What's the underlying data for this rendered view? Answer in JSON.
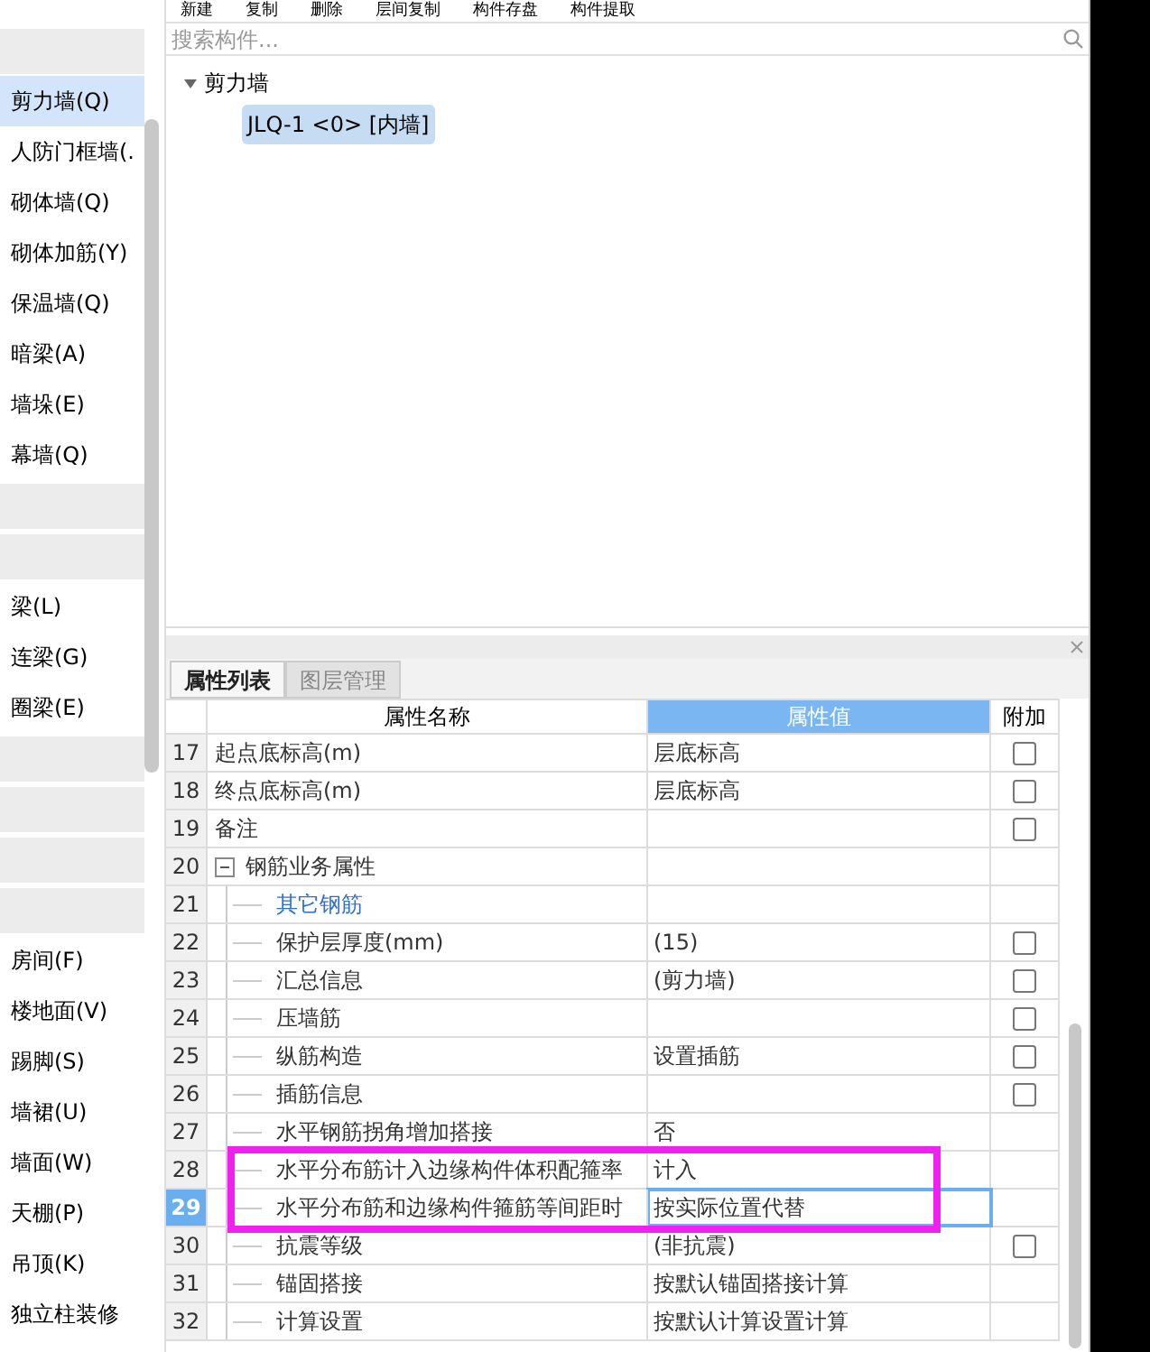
{
  "sidebar": {
    "items": [
      {
        "kind": "group"
      },
      {
        "kind": "item",
        "label": "剪力墙(Q)",
        "selected": true
      },
      {
        "kind": "item",
        "label": "人防门框墙(.",
        "selected": false
      },
      {
        "kind": "item",
        "label": "砌体墙(Q)",
        "selected": false
      },
      {
        "kind": "item",
        "label": "砌体加筋(Y)",
        "selected": false
      },
      {
        "kind": "item",
        "label": "保温墙(Q)",
        "selected": false
      },
      {
        "kind": "item",
        "label": "暗梁(A)",
        "selected": false
      },
      {
        "kind": "item",
        "label": "墙垛(E)",
        "selected": false
      },
      {
        "kind": "item",
        "label": "幕墙(Q)",
        "selected": false
      },
      {
        "kind": "group"
      },
      {
        "kind": "group"
      },
      {
        "kind": "item",
        "label": "梁(L)",
        "selected": false
      },
      {
        "kind": "item",
        "label": "连梁(G)",
        "selected": false
      },
      {
        "kind": "item",
        "label": "圈梁(E)",
        "selected": false
      },
      {
        "kind": "group"
      },
      {
        "kind": "group"
      },
      {
        "kind": "group"
      },
      {
        "kind": "group"
      },
      {
        "kind": "item",
        "label": "房间(F)",
        "selected": false
      },
      {
        "kind": "item",
        "label": "楼地面(V)",
        "selected": false
      },
      {
        "kind": "item",
        "label": "踢脚(S)",
        "selected": false
      },
      {
        "kind": "item",
        "label": "墙裙(U)",
        "selected": false
      },
      {
        "kind": "item",
        "label": "墙面(W)",
        "selected": false
      },
      {
        "kind": "item",
        "label": "天棚(P)",
        "selected": false
      },
      {
        "kind": "item",
        "label": "吊顶(K)",
        "selected": false
      },
      {
        "kind": "item",
        "label": "独立柱装修",
        "selected": false
      }
    ]
  },
  "toolbar": [
    {
      "label": "新建"
    },
    {
      "label": "复制"
    },
    {
      "label": "删除"
    },
    {
      "label": "层间复制"
    },
    {
      "label": "构件存盘"
    },
    {
      "label": "构件提取"
    }
  ],
  "search": {
    "placeholder": "搜索构件..."
  },
  "tree": {
    "label": "剪力墙",
    "expanded": true,
    "children": [
      {
        "label": "JLQ-1 <0> [内墙]",
        "selected": true
      }
    ]
  },
  "tabs": [
    {
      "label": "属性列表",
      "selected": true
    },
    {
      "label": "图层管理",
      "selected": false
    }
  ],
  "table": {
    "columns": [
      "属性名称",
      "属性值",
      "附加"
    ],
    "rows": [
      {
        "index": "17",
        "name": "起点底标高(m)",
        "value": "层底标高",
        "kind": "check",
        "checked": false,
        "selected": false
      },
      {
        "index": "18",
        "name": "终点底标高(m)",
        "value": "层底标高",
        "kind": "check",
        "checked": false,
        "selected": false
      },
      {
        "index": "19",
        "name": "备注",
        "kind": "check",
        "checked": false,
        "selected": false
      },
      {
        "index": "20",
        "name": "钢筋业务属性",
        "kind": "plain",
        "selected": false,
        "expanded": true,
        "children": [
          {
            "index": "21",
            "name": "其它钢筋",
            "kind": "link",
            "selected": false
          },
          {
            "index": "22",
            "name": "保护层厚度(mm)",
            "value": "(15)",
            "kind": "check",
            "checked": false,
            "selected": false
          },
          {
            "index": "23",
            "name": "汇总信息",
            "value": "(剪力墙)",
            "kind": "check",
            "checked": false,
            "selected": false
          },
          {
            "index": "24",
            "name": "压墙筋",
            "kind": "check",
            "checked": false,
            "selected": false
          },
          {
            "index": "25",
            "name": "纵筋构造",
            "value": "设置插筋",
            "kind": "check",
            "checked": false,
            "selected": false
          },
          {
            "index": "26",
            "name": "插筋信息",
            "kind": "check",
            "checked": false,
            "selected": false
          },
          {
            "index": "27",
            "name": "水平钢筋拐角增加搭接",
            "value": "否",
            "kind": "plain",
            "selected": false
          },
          {
            "index": "28",
            "name": "水平分布筋计入边缘构件体积配箍率",
            "value": "计入",
            "kind": "plain",
            "selected": false
          },
          {
            "index": "29",
            "name": "水平分布筋和边缘构件箍筋等间距时",
            "value": "按实际位置代替",
            "kind": "plain",
            "selected": true
          },
          {
            "index": "30",
            "name": "抗震等级",
            "value": "(非抗震)",
            "kind": "check",
            "checked": false,
            "selected": false
          },
          {
            "index": "31",
            "name": "锚固搭接",
            "value": "按默认锚固搭接计算",
            "kind": "plain",
            "selected": false
          },
          {
            "index": "32",
            "name": "计算设置",
            "value": "按默认计算设置计算",
            "kind": "plain",
            "selected": false
          }
        ]
      }
    ]
  }
}
